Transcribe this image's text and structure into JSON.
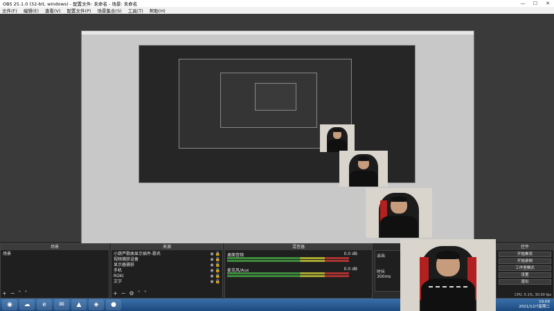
{
  "window": {
    "title": "OBS 25.1.0 (32-bit, windows) - 配置文件: 未命名 - 场景: 未命名"
  },
  "menu": [
    "文件(F)",
    "编辑(E)",
    "查看(V)",
    "配置文件(P)",
    "场景集合(S)",
    "工具(T)",
    "帮助(H)"
  ],
  "docks": {
    "scenes": {
      "title": "场景",
      "items": [
        "场景"
      ]
    },
    "sources": {
      "title": "来源",
      "items": [
        "小葫芦歌曲显示插件-歌名",
        "视频捕获设备",
        "显示器捕获",
        "手机",
        "ROKI",
        "文字"
      ]
    },
    "mixer": {
      "title": "混音器",
      "channels": [
        {
          "name": "桌面音频",
          "db": "0.0 dB"
        },
        {
          "name": "麦克风/Aux",
          "db": "0.0 dB"
        }
      ]
    },
    "transitions": {
      "label1": "淡出",
      "label2": "时长",
      "value": "300ms"
    }
  },
  "controls": {
    "title": "控件",
    "buttons": [
      "开始推流",
      "开始录制",
      "工作室模式",
      "设置",
      "退出"
    ]
  },
  "status": "CPU: 5.1%, 30.00 fps",
  "clock": {
    "time": "19:09",
    "date": "2021/12/7星期二"
  },
  "taskbar_icons": [
    "start-orb-icon",
    "cloud-icon",
    "browser-icon",
    "chat-icon",
    "app-icon",
    "game-icon",
    "obs-icon"
  ]
}
